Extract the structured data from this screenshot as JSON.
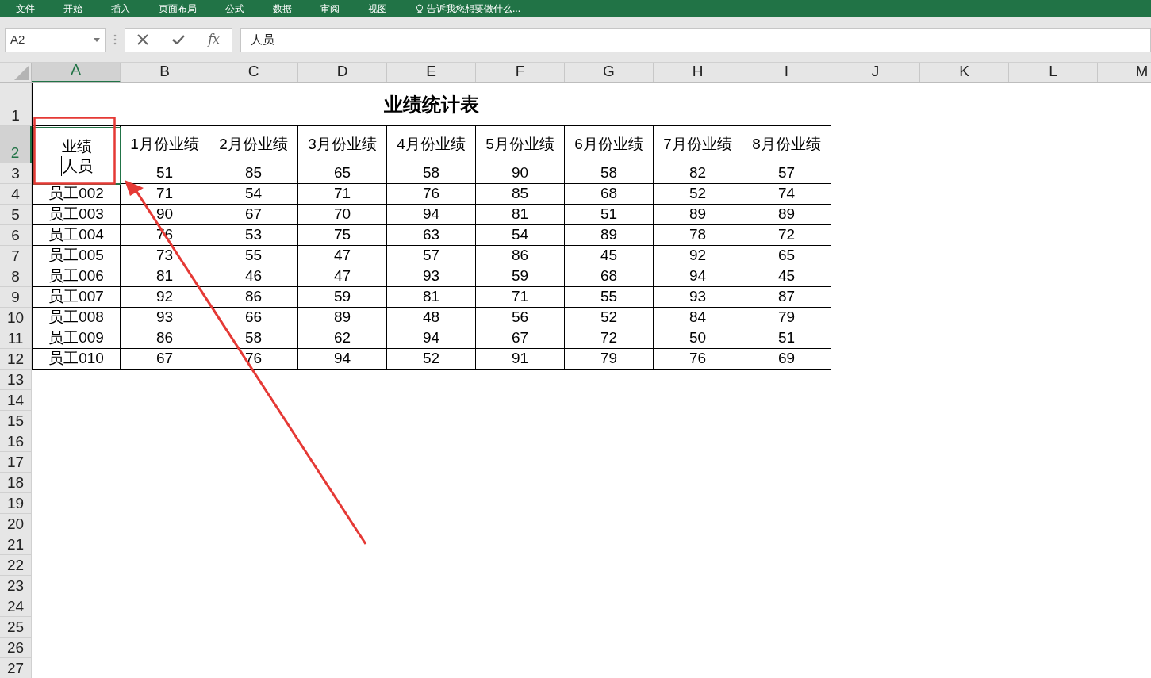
{
  "ribbon": {
    "tabs": [
      {
        "label": "文件",
        "selected": false
      },
      {
        "label": "开始",
        "selected": false
      },
      {
        "label": "插入",
        "selected": false
      },
      {
        "label": "页面布局",
        "selected": false
      },
      {
        "label": "公式",
        "selected": false
      },
      {
        "label": "数据",
        "selected": false
      },
      {
        "label": "审阅",
        "selected": false
      },
      {
        "label": "视图",
        "selected": false
      }
    ],
    "tell_me": "告诉我您想要做什么..."
  },
  "name_box": "A2",
  "insert_function": "fx",
  "formula": "人员",
  "columns": [
    {
      "label": "A",
      "selected": true
    },
    {
      "label": "B",
      "selected": false
    },
    {
      "label": "C",
      "selected": false
    },
    {
      "label": "D",
      "selected": false
    },
    {
      "label": "E",
      "selected": false
    },
    {
      "label": "F",
      "selected": false
    },
    {
      "label": "G",
      "selected": false
    },
    {
      "label": "H",
      "selected": false
    },
    {
      "label": "I",
      "selected": false
    },
    {
      "label": "J",
      "selected": false
    },
    {
      "label": "K",
      "selected": false
    },
    {
      "label": "L",
      "selected": false
    },
    {
      "label": "M",
      "selected": false
    }
  ],
  "row_numbers": [
    {
      "label": "1",
      "selected": false
    },
    {
      "label": "2",
      "selected": true
    },
    {
      "label": "3",
      "selected": false
    },
    {
      "label": "4",
      "selected": false
    },
    {
      "label": "5",
      "selected": false
    },
    {
      "label": "6",
      "selected": false
    },
    {
      "label": "7",
      "selected": false
    },
    {
      "label": "8",
      "selected": false
    },
    {
      "label": "9",
      "selected": false
    },
    {
      "label": "10",
      "selected": false
    },
    {
      "label": "11",
      "selected": false
    },
    {
      "label": "12",
      "selected": false
    },
    {
      "label": "13",
      "selected": false
    },
    {
      "label": "14",
      "selected": false
    },
    {
      "label": "15",
      "selected": false
    },
    {
      "label": "16",
      "selected": false
    },
    {
      "label": "17",
      "selected": false
    },
    {
      "label": "18",
      "selected": false
    },
    {
      "label": "19",
      "selected": false
    },
    {
      "label": "20",
      "selected": false
    },
    {
      "label": "21",
      "selected": false
    },
    {
      "label": "22",
      "selected": false
    },
    {
      "label": "23",
      "selected": false
    },
    {
      "label": "24",
      "selected": false
    },
    {
      "label": "25",
      "selected": false
    },
    {
      "label": "26",
      "selected": false
    },
    {
      "label": "27",
      "selected": false
    }
  ],
  "sheet": {
    "title": "业绩统计表",
    "corner_header": {
      "lines": [
        "业绩",
        "人员"
      ],
      "editing": true
    },
    "headers": [
      "1月份业绩",
      "2月份业绩",
      "3月份业绩",
      "4月份业绩",
      "5月份业绩",
      "6月份业绩",
      "7月份业绩",
      "8月份业绩"
    ],
    "rows": [
      {
        "values": [
          "51",
          "85",
          "65",
          "58",
          "90",
          "58",
          "82",
          "57"
        ]
      },
      {
        "name": "员工002",
        "values": [
          "71",
          "54",
          "71",
          "76",
          "85",
          "68",
          "52",
          "74"
        ]
      },
      {
        "name": "员工003",
        "values": [
          "90",
          "67",
          "70",
          "94",
          "81",
          "51",
          "89",
          "89"
        ]
      },
      {
        "name": "员工004",
        "values": [
          "76",
          "53",
          "75",
          "63",
          "54",
          "89",
          "78",
          "72"
        ]
      },
      {
        "name": "员工005",
        "values": [
          "73",
          "55",
          "47",
          "57",
          "86",
          "45",
          "92",
          "65"
        ]
      },
      {
        "name": "员工006",
        "values": [
          "81",
          "46",
          "47",
          "93",
          "59",
          "68",
          "94",
          "45"
        ]
      },
      {
        "name": "员工007",
        "values": [
          "92",
          "86",
          "59",
          "81",
          "71",
          "55",
          "93",
          "87"
        ]
      },
      {
        "name": "员工008",
        "values": [
          "93",
          "66",
          "89",
          "48",
          "56",
          "52",
          "84",
          "79"
        ]
      },
      {
        "name": "员工009",
        "values": [
          "86",
          "58",
          "62",
          "94",
          "67",
          "72",
          "50",
          "51"
        ]
      },
      {
        "name": "员工010",
        "values": [
          "67",
          "76",
          "94",
          "52",
          "91",
          "79",
          "76",
          "69"
        ]
      }
    ]
  }
}
